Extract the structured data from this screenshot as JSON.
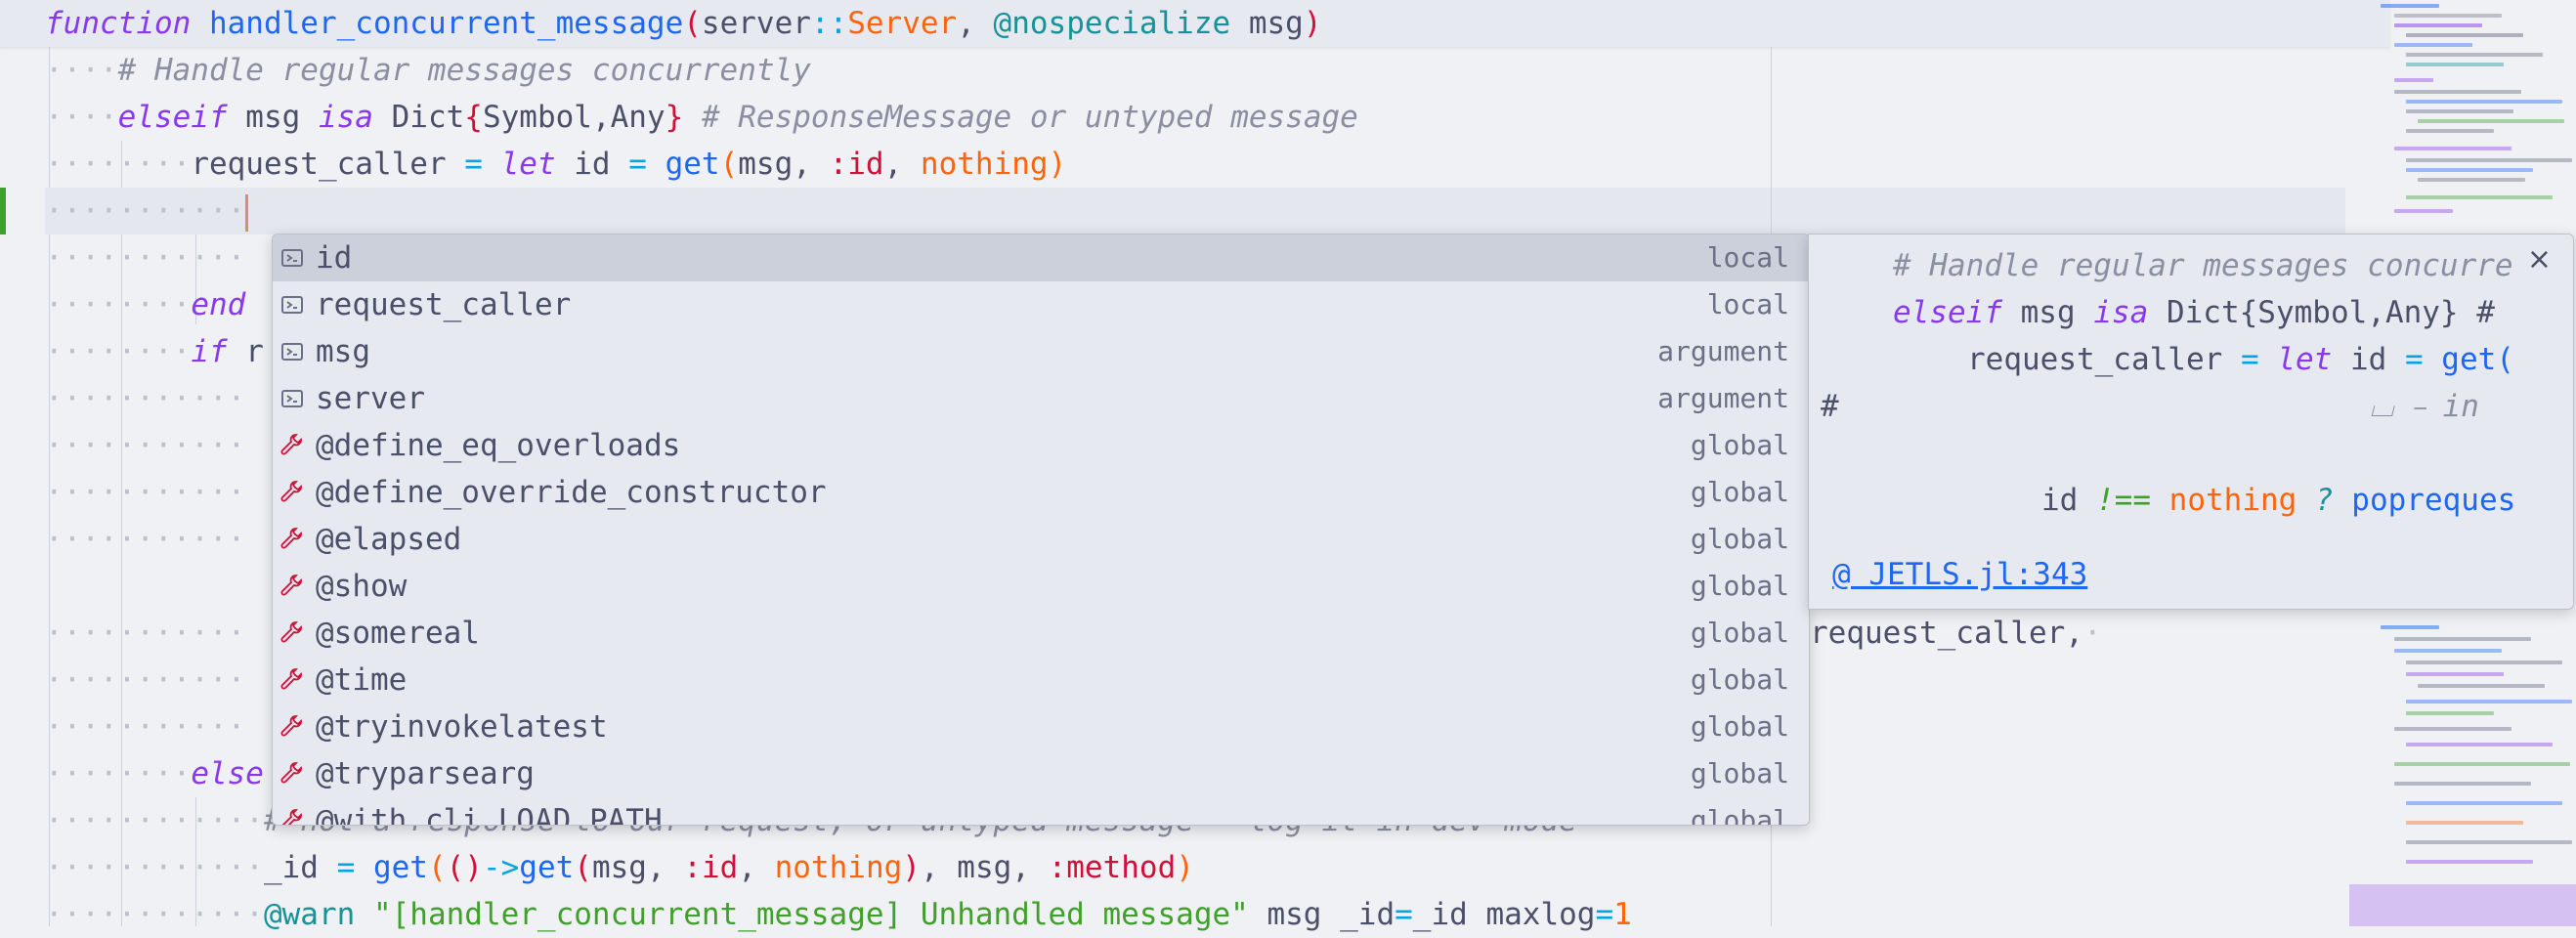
{
  "editor": {
    "sticky": {
      "kw_function": "function",
      "fn_name": "handler_concurrent_message",
      "paren_open": "(",
      "arg_server": "server",
      "op_typeassert": "::",
      "type_server": "Server",
      "comma": ", ",
      "macro": "@nospecialize",
      "arg_msg": " msg",
      "paren_close": ")"
    },
    "line1_comment": "# Handle regular messages concurrently",
    "line2": {
      "kw_elseif": "elseif",
      "msg": " msg ",
      "kw_isa": "isa",
      "dict": " Dict",
      "brace_open": "{",
      "type_params": "Symbol,Any",
      "brace_close": "}",
      "comment": " # ResponseMessage or untyped message"
    },
    "line3": {
      "lhs": "request_caller ",
      "eq": "=",
      "kw_let": " let",
      "id": " id ",
      "eq2": "=",
      "get": " get",
      "po": "(",
      "msg": "msg, ",
      "sym": ":id",
      "comma": ", ",
      "nothing": "nothing",
      "pc": ")"
    },
    "line6_end": "end",
    "line7_if": "if",
    "line7_rest": " r",
    "line12_tail": "request_caller,",
    "line16_else": "else",
    "line17_comment": "# not a response to our request, or untyped message - log it in dev mode",
    "line18": {
      "lhs": "_id ",
      "eq": "=",
      "get1": " get",
      "po1": "(",
      "po2": "(",
      "pc2": ")",
      "arrow": "->",
      "get2": "get",
      "po3": "(",
      "msg": "msg, ",
      "sym": ":id",
      "comma": ", ",
      "nothing": "nothing",
      "pc3": ")",
      "rest": ", msg, ",
      "sym2": ":method",
      "pc1": ")"
    },
    "line19": {
      "macro": "@warn",
      "str": " \"[handler_concurrent_message] Unhandled message\"",
      "rest1": " msg _id",
      "eq": "=",
      "rest2": "_id maxlog",
      "eq2": "=",
      "num": "1"
    }
  },
  "suggest": {
    "items": [
      {
        "label": "id",
        "kind": "local",
        "icon": "variable-icon"
      },
      {
        "label": "request_caller",
        "kind": "local",
        "icon": "variable-icon"
      },
      {
        "label": "msg",
        "kind": "argument",
        "icon": "variable-icon"
      },
      {
        "label": "server",
        "kind": "argument",
        "icon": "variable-icon"
      },
      {
        "label": "@define_eq_overloads",
        "kind": "global",
        "icon": "wrench-icon"
      },
      {
        "label": "@define_override_constructor",
        "kind": "global",
        "icon": "wrench-icon"
      },
      {
        "label": "@elapsed",
        "kind": "global",
        "icon": "wrench-icon"
      },
      {
        "label": "@show",
        "kind": "global",
        "icon": "wrench-icon"
      },
      {
        "label": "@somereal",
        "kind": "global",
        "icon": "wrench-icon"
      },
      {
        "label": "@time",
        "kind": "global",
        "icon": "wrench-icon"
      },
      {
        "label": "@tryinvokelatest",
        "kind": "global",
        "icon": "wrench-icon"
      },
      {
        "label": "@tryparsearg",
        "kind": "global",
        "icon": "wrench-icon"
      },
      {
        "label": "@with_cli_LOAD_PATH",
        "kind": "global",
        "icon": "wrench-icon"
      }
    ]
  },
  "details": {
    "close": "×",
    "l1_comment": "# Handle regular messages concurre",
    "l2_elseif": "elseif",
    "l2_msg": " msg ",
    "l2_isa": "isa",
    "l2_dict": " Dict{Symbol,Any} #",
    "l3_lhs": "request_caller ",
    "l3_eq": "=",
    "l3_let": " let",
    "l3_id": " id ",
    "l3_eq2": "=",
    "l3_get": " get(",
    "l4_hash": "#",
    "l4_in": "⌴ ⎯ in",
    "l5_id": "id ",
    "l5_op": "!==",
    "l5_nothing": " nothing",
    "l5_q": " ?",
    "l5_pop": " popreques",
    "link": "@ JETLS.jl:343"
  },
  "colors": {
    "background": "#eff1f5",
    "keyword": "#8839ef",
    "function": "#1e66f5",
    "type": "#fe640b",
    "string": "#40a02b",
    "symbol": "#d20f39",
    "comment": "#8c8fa1",
    "macro": "#179299"
  }
}
